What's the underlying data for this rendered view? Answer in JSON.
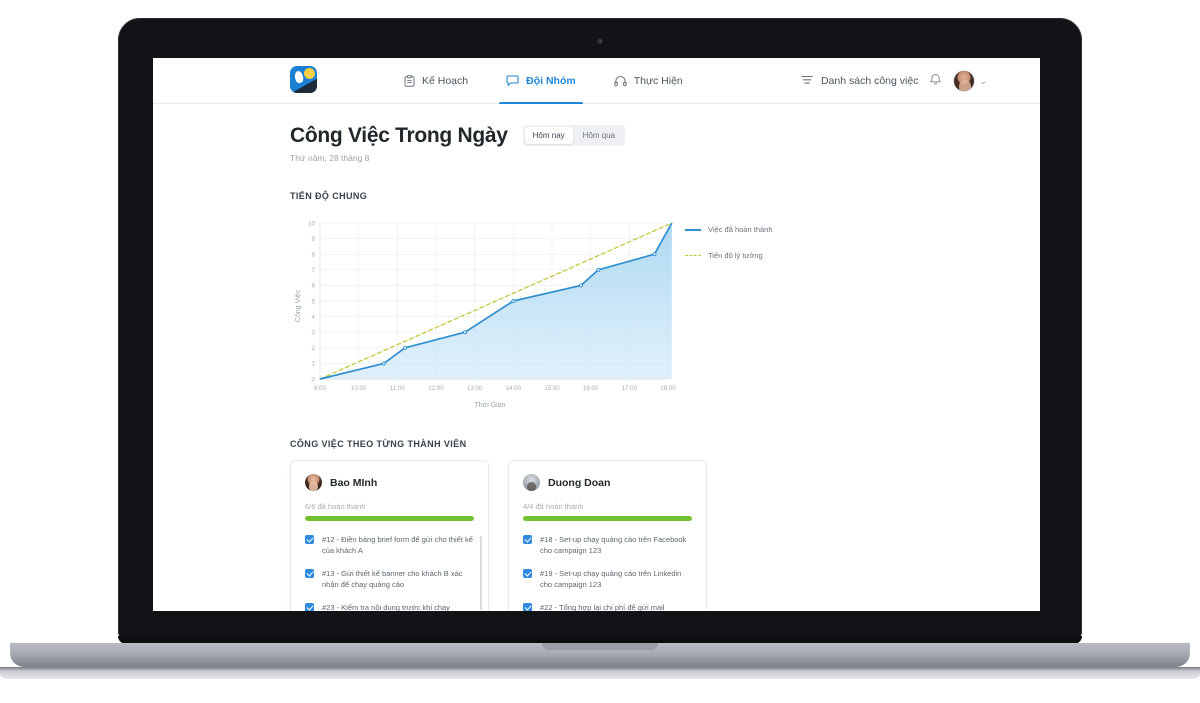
{
  "header": {
    "logo_name": "app-logo",
    "nav": [
      {
        "label": "Kế Hoạch",
        "icon": "clipboard-icon",
        "active": false
      },
      {
        "label": "Đội Nhóm",
        "icon": "chat-bubble-icon",
        "active": true
      },
      {
        "label": "Thực Hiện",
        "icon": "headphones-icon",
        "active": false
      }
    ],
    "task_list_label": "Danh sách công việc",
    "task_list_icon": "list-icon",
    "bell_icon": "bell-icon",
    "avatar_name": "user-avatar",
    "chevron": "⌄"
  },
  "page": {
    "title": "Công Việc Trong Ngày",
    "subtitle": "Thứ năm, 28 tháng 8",
    "toggles": [
      {
        "label": "Hôm nay",
        "active": true
      },
      {
        "label": "Hôm qua",
        "active": false
      }
    ],
    "progress_section_label": "TIẾN ĐỘ CHUNG",
    "members_section_label": "CÔNG VIỆC THEO TỪNG THÀNH VIÊN"
  },
  "chart_data": {
    "type": "line",
    "title": "TIẾN ĐỘ CHUNG",
    "xlabel": "Thời Gian",
    "ylabel": "Công Việc",
    "grid": true,
    "legend_position": "right",
    "xlim": [
      9,
      18
    ],
    "ylim": [
      0,
      10
    ],
    "xtick_labels": [
      "9:00",
      "10:00",
      "11:00",
      "12:00",
      "13:00",
      "14:00",
      "15:00",
      "16:00",
      "17:00",
      "18:00"
    ],
    "ytick_labels": [
      "0",
      "1",
      "2",
      "3",
      "4",
      "5",
      "6",
      "7",
      "8",
      "9",
      "10"
    ],
    "series": [
      {
        "name": "Việc đã hoàn thành",
        "color": "#2f8fd0",
        "style": "solid",
        "filled": true,
        "points": [
          {
            "x": 9.0,
            "y": 0
          },
          {
            "x": 10.65,
            "y": 1
          },
          {
            "x": 11.2,
            "y": 2
          },
          {
            "x": 12.75,
            "y": 3
          },
          {
            "x": 14.0,
            "y": 5
          },
          {
            "x": 15.75,
            "y": 6
          },
          {
            "x": 16.2,
            "y": 7
          },
          {
            "x": 17.65,
            "y": 8
          },
          {
            "x": 18.1,
            "y": 10
          }
        ]
      },
      {
        "name": "Tiến độ lý tưởng",
        "color": "#c3c93f",
        "style": "dashed",
        "filled": false,
        "points": [
          {
            "x": 9.0,
            "y": 0
          },
          {
            "x": 18.1,
            "y": 10
          }
        ]
      }
    ]
  },
  "members": [
    {
      "name": "Bao MInh",
      "avatar": "female-avatar",
      "progress_text": "6/6 đã hoàn thành",
      "progress_percent": 100,
      "tasks": [
        {
          "id": "#12",
          "checked": true,
          "text": "#12 - Điền bảng brief form để gửi cho thiết kế của khách A"
        },
        {
          "id": "#13",
          "checked": true,
          "text": "#13 - Gửi thiết kế banner cho khách B xác nhận để chạy quảng cáo"
        },
        {
          "id": "#23",
          "checked": true,
          "text": "#23 - Kiểm tra nội dung trước khi chạy"
        }
      ]
    },
    {
      "name": "Duong Doan",
      "avatar": "male-avatar",
      "progress_text": "4/4 đã hoàn thành",
      "progress_percent": 100,
      "tasks": [
        {
          "id": "#18",
          "checked": true,
          "text": "#18 - Set-up chạy quảng cáo trên Facebook cho campaign 123"
        },
        {
          "id": "#19",
          "checked": true,
          "text": "#19 - Set-up chạy quảng cáo trên Linkedin cho campaign 123"
        },
        {
          "id": "#22",
          "checked": true,
          "text": "#22 - Tổng hợp lại chi phí để gửi mail"
        }
      ]
    }
  ],
  "colors": {
    "accent": "#1f87d8",
    "chart_line": "#2f8fd0",
    "chart_ideal": "#c3c93f",
    "progress": "#72c02c",
    "checkbox": "#2f8ae0"
  }
}
